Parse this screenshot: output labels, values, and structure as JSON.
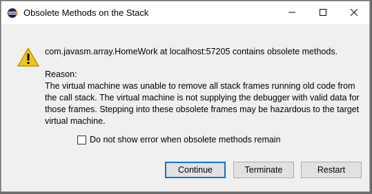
{
  "window": {
    "title": "Obsolete Methods on the Stack",
    "controls": [
      "minimize-icon",
      "maximize-icon",
      "close-icon"
    ]
  },
  "message": {
    "headline": "com.javasm.array.HomeWork at localhost:57205 contains obsolete methods.",
    "reason_label": "Reason:",
    "reason_text": "The virtual machine was unable to remove all stack frames running old code from the call stack. The virtual machine is not supplying the debugger with valid data for those frames. Stepping into these obsolete frames may be hazardous to the target virtual machine."
  },
  "checkbox": {
    "label": "Do not show error when obsolete methods remain",
    "checked": false
  },
  "buttons": {
    "continue": "Continue",
    "terminate": "Terminate",
    "restart": "Restart"
  },
  "colors": {
    "accent": "#0078d7",
    "warning": "#f0c419"
  }
}
